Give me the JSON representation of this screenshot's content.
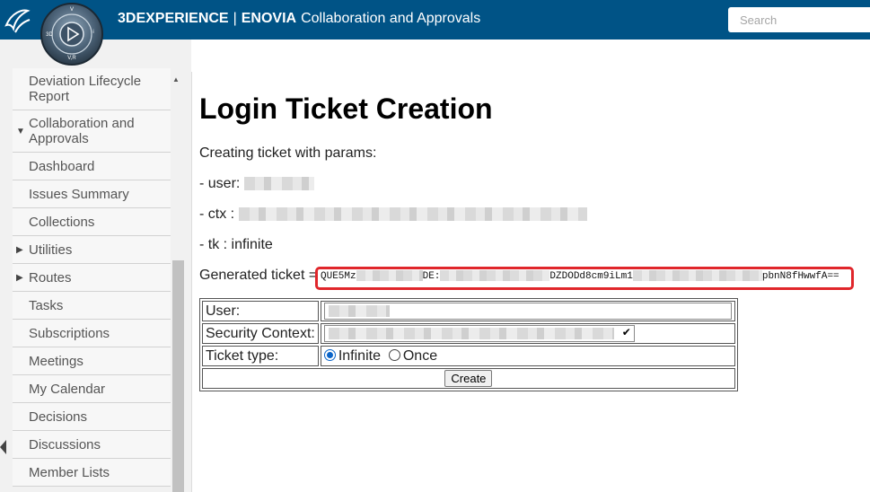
{
  "header": {
    "brand_bold": "3DEXPERIENCE",
    "separator": "|",
    "brand_product": "ENOVIA",
    "app_name": "Collaboration and Approvals",
    "search_placeholder": "Search",
    "compass_labels": {
      "top": "V",
      "left": "3D",
      "right": "i",
      "bottom": "V,R"
    }
  },
  "sidebar": {
    "items": [
      {
        "label": "Deviation Lifecycle Report",
        "expander": ""
      },
      {
        "label": "Collaboration and Approvals",
        "expander": "expanded"
      },
      {
        "label": "Dashboard",
        "expander": ""
      },
      {
        "label": "Issues Summary",
        "expander": ""
      },
      {
        "label": "Collections",
        "expander": ""
      },
      {
        "label": "Utilities",
        "expander": "collapsed"
      },
      {
        "label": "Routes",
        "expander": "collapsed"
      },
      {
        "label": "Tasks",
        "expander": ""
      },
      {
        "label": "Subscriptions",
        "expander": ""
      },
      {
        "label": "Meetings",
        "expander": ""
      },
      {
        "label": "My Calendar",
        "expander": ""
      },
      {
        "label": "Decisions",
        "expander": ""
      },
      {
        "label": "Discussions",
        "expander": ""
      },
      {
        "label": "Member Lists",
        "expander": ""
      }
    ]
  },
  "main": {
    "title": "Login Ticket Creation",
    "params_intro": "Creating ticket with params:",
    "user_label": "- user:",
    "ctx_label": "- ctx :",
    "tk_line": "- tk : infinite",
    "generated_label": "Generated ticket =",
    "ticket_parts": [
      "QUE5Mz",
      "DE:",
      "DZDODd8cm9iLm1",
      "pbnN8fHwwfA=="
    ]
  },
  "form": {
    "user_label": "User:",
    "security_label": "Security Context:",
    "ticket_type_label": "Ticket type:",
    "option_infinite": "Infinite",
    "option_once": "Once",
    "selected_type": "Infinite",
    "create_button": "Create"
  },
  "colors": {
    "topbar": "#005386",
    "highlight_box": "#e0262b",
    "radio_selected": "#0a64c8"
  }
}
